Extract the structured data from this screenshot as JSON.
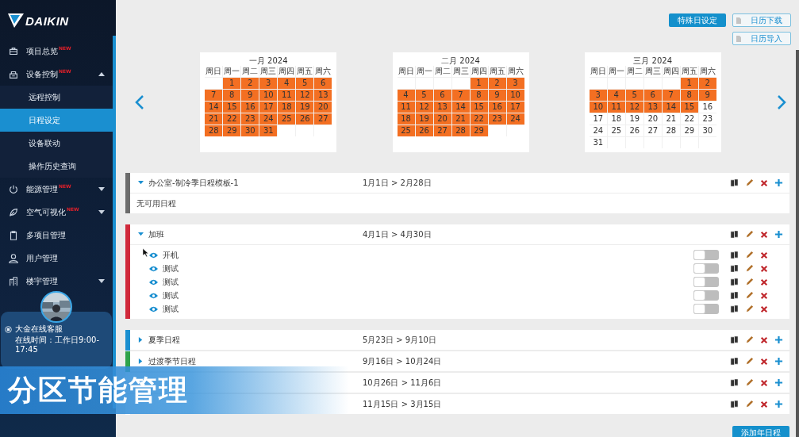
{
  "logo": {
    "text": "DAIKIN"
  },
  "sidebar": {
    "items": [
      {
        "label": "项目总览",
        "badge": "NEW",
        "selected": false
      },
      {
        "label": "设备控制",
        "badge": "NEW",
        "selected": false,
        "expanded": true,
        "children": [
          {
            "label": "远程控制",
            "selected": false
          },
          {
            "label": "日程设定",
            "selected": true
          },
          {
            "label": "设备联动",
            "selected": false
          },
          {
            "label": "操作历史查询",
            "selected": false
          }
        ]
      },
      {
        "label": "能源管理",
        "badge": "NEW",
        "selected": false,
        "expanded": false
      },
      {
        "label": "空气可视化",
        "badge": "NEW",
        "selected": false,
        "expanded": false
      },
      {
        "label": "多项目管理",
        "selected": false
      },
      {
        "label": "用户管理",
        "selected": false
      },
      {
        "label": "楼宇管理",
        "selected": false,
        "expanded": false
      }
    ],
    "support": {
      "title": "大金在线客服",
      "hours": "在线时间：工作日9:00-17:45"
    }
  },
  "toolbar": {
    "buttons": [
      {
        "label": "特殊日设定",
        "kind": "primary"
      },
      {
        "label": "日历下载",
        "kind": "file"
      },
      {
        "label": "日历导入",
        "kind": "file"
      }
    ]
  },
  "calendars": [
    {
      "title": "一月 2024",
      "weekdays": [
        "周日",
        "周一",
        "周二",
        "周三",
        "周四",
        "周五",
        "周六"
      ],
      "days": [
        {
          "kind": "blank"
        },
        {
          "day": "1",
          "highlighted": true
        },
        {
          "day": "2",
          "highlighted": true
        },
        {
          "day": "3",
          "highlighted": true
        },
        {
          "day": "4",
          "highlighted": true
        },
        {
          "day": "5",
          "highlighted": true
        },
        {
          "day": "6",
          "highlighted": true
        },
        {
          "day": "7",
          "highlighted": true
        },
        {
          "day": "8",
          "highlighted": true
        },
        {
          "day": "9",
          "highlighted": true
        },
        {
          "day": "10",
          "highlighted": true
        },
        {
          "day": "11",
          "highlighted": true
        },
        {
          "day": "12",
          "highlighted": true
        },
        {
          "day": "13",
          "highlighted": true
        },
        {
          "day": "14",
          "highlighted": true
        },
        {
          "day": "15",
          "highlighted": true
        },
        {
          "day": "16",
          "highlighted": true
        },
        {
          "day": "17",
          "highlighted": true
        },
        {
          "day": "18",
          "highlighted": true
        },
        {
          "day": "19",
          "highlighted": true
        },
        {
          "day": "20",
          "highlighted": true
        },
        {
          "day": "21",
          "highlighted": true
        },
        {
          "day": "22",
          "highlighted": true
        },
        {
          "day": "23",
          "highlighted": true
        },
        {
          "day": "24",
          "highlighted": true
        },
        {
          "day": "25",
          "highlighted": true
        },
        {
          "day": "26",
          "highlighted": true
        },
        {
          "day": "27",
          "highlighted": true
        },
        {
          "day": "28",
          "highlighted": true
        },
        {
          "day": "29",
          "highlighted": true
        },
        {
          "day": "30",
          "highlighted": true
        },
        {
          "day": "31",
          "highlighted": true
        },
        {
          "kind": "blank"
        },
        {
          "kind": "blank"
        },
        {
          "kind": "blank"
        }
      ]
    },
    {
      "title": "二月 2024",
      "weekdays": [
        "周日",
        "周一",
        "周二",
        "周三",
        "周四",
        "周五",
        "周六"
      ],
      "days": [
        {
          "kind": "blank"
        },
        {
          "kind": "blank"
        },
        {
          "kind": "blank"
        },
        {
          "kind": "blank"
        },
        {
          "day": "1",
          "highlighted": true
        },
        {
          "day": "2",
          "highlighted": true
        },
        {
          "day": "3",
          "highlighted": true
        },
        {
          "day": "4",
          "highlighted": true
        },
        {
          "day": "5",
          "highlighted": true
        },
        {
          "day": "6",
          "highlighted": true
        },
        {
          "day": "7",
          "highlighted": true
        },
        {
          "day": "8",
          "highlighted": true
        },
        {
          "day": "9",
          "highlighted": true
        },
        {
          "day": "10",
          "highlighted": true
        },
        {
          "day": "11",
          "highlighted": true
        },
        {
          "day": "12",
          "highlighted": true
        },
        {
          "day": "13",
          "highlighted": true
        },
        {
          "day": "14",
          "highlighted": true
        },
        {
          "day": "15",
          "highlighted": true
        },
        {
          "day": "16",
          "highlighted": true
        },
        {
          "day": "17",
          "highlighted": true
        },
        {
          "day": "18",
          "highlighted": true
        },
        {
          "day": "19",
          "highlighted": true
        },
        {
          "day": "20",
          "highlighted": true
        },
        {
          "day": "21",
          "highlighted": true
        },
        {
          "day": "22",
          "highlighted": true
        },
        {
          "day": "23",
          "highlighted": true
        },
        {
          "day": "24",
          "highlighted": true
        },
        {
          "day": "25",
          "highlighted": true
        },
        {
          "day": "26",
          "highlighted": true
        },
        {
          "day": "27",
          "highlighted": true
        },
        {
          "day": "28",
          "highlighted": true
        },
        {
          "day": "29",
          "highlighted": true
        },
        {
          "kind": "blank"
        },
        {
          "kind": "blank"
        }
      ]
    },
    {
      "title": "三月 2024",
      "weekdays": [
        "周日",
        "周一",
        "周二",
        "周三",
        "周四",
        "周五",
        "周六"
      ],
      "days": [
        {
          "kind": "blank"
        },
        {
          "kind": "blank"
        },
        {
          "kind": "blank"
        },
        {
          "kind": "blank"
        },
        {
          "kind": "blank"
        },
        {
          "day": "1",
          "highlighted": true
        },
        {
          "day": "2",
          "highlighted": true
        },
        {
          "day": "3",
          "highlighted": true
        },
        {
          "day": "4",
          "highlighted": true
        },
        {
          "day": "5",
          "highlighted": true
        },
        {
          "day": "6",
          "highlighted": true
        },
        {
          "day": "7",
          "highlighted": true
        },
        {
          "day": "8",
          "highlighted": true
        },
        {
          "day": "9",
          "highlighted": true
        },
        {
          "day": "10",
          "highlighted": true
        },
        {
          "day": "11",
          "highlighted": true
        },
        {
          "day": "12",
          "highlighted": true
        },
        {
          "day": "13",
          "highlighted": true
        },
        {
          "day": "14",
          "highlighted": true
        },
        {
          "day": "15",
          "highlighted": true
        },
        {
          "day": "16",
          "highlighted": false
        },
        {
          "day": "17",
          "highlighted": false
        },
        {
          "day": "18",
          "highlighted": false
        },
        {
          "day": "19",
          "highlighted": false
        },
        {
          "day": "20",
          "highlighted": false
        },
        {
          "day": "21",
          "highlighted": false
        },
        {
          "day": "22",
          "highlighted": false
        },
        {
          "day": "23",
          "highlighted": false
        },
        {
          "day": "24",
          "highlighted": false
        },
        {
          "day": "25",
          "highlighted": false
        },
        {
          "day": "26",
          "highlighted": false
        },
        {
          "day": "27",
          "highlighted": false
        },
        {
          "day": "28",
          "highlighted": false
        },
        {
          "day": "29",
          "highlighted": false
        },
        {
          "day": "30",
          "highlighted": false
        },
        {
          "day": "31",
          "highlighted": false
        },
        {
          "kind": "blank"
        },
        {
          "kind": "blank"
        },
        {
          "kind": "blank"
        },
        {
          "kind": "blank"
        },
        {
          "kind": "blank"
        },
        {
          "kind": "blank"
        }
      ]
    }
  ],
  "schedules": [
    {
      "name": "办公室-制冷季日程模板-1",
      "date_range": "1月1日 > 2月28日",
      "color": "#6b6b6b",
      "expanded": true,
      "empty_text": "无可用日程"
    },
    {
      "name": "加班",
      "date_range": "4月1日 > 4月30日",
      "color": "#d0293b",
      "expanded": true,
      "items": [
        {
          "name": "开机",
          "on": false
        },
        {
          "name": "测试",
          "on": false
        },
        {
          "name": "测试",
          "on": false
        },
        {
          "name": "测试",
          "on": false
        },
        {
          "name": "测试",
          "on": false
        }
      ]
    },
    {
      "name": "夏季日程",
      "date_range": "5月23日 > 9月10日",
      "color": "#1a8fd0",
      "expanded": false
    },
    {
      "name": "过渡季节日程",
      "date_range": "9月16日 > 10月24日",
      "color": "#2ea24a",
      "expanded": false
    },
    {
      "date_range": "10月26日 > 11月6日"
    },
    {
      "date_range": "11月15日 > 3月15日"
    }
  ],
  "add_button": "添加年日程",
  "banner": {
    "text": "分区节能管理"
  }
}
